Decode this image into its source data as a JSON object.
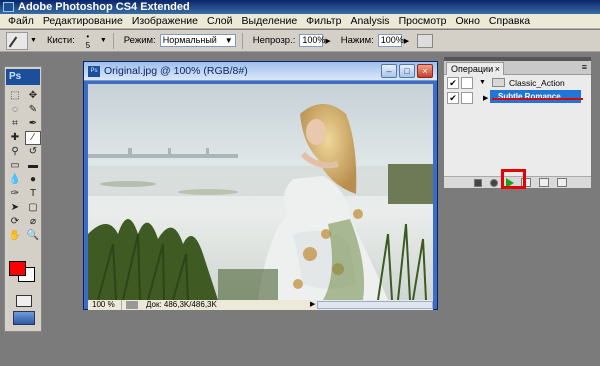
{
  "app": {
    "title": "Adobe Photoshop CS4 Extended"
  },
  "menu": [
    "Файл",
    "Редактирование",
    "Изображение",
    "Слой",
    "Выделение",
    "Фильтр",
    "Analysis",
    "Просмотр",
    "Окно",
    "Справка"
  ],
  "options": {
    "brushes_label": "Кисти:",
    "brush_size": "5",
    "mode_label": "Режим:",
    "mode_value": "Нормальный",
    "opacity_label": "Непрозр.:",
    "opacity_value": "100%",
    "flow_label": "Нажим:",
    "flow_value": "100%"
  },
  "toolbox": {
    "logo": "Ps",
    "foreground_color": "#ff0000",
    "background_color": "#ffffff"
  },
  "document": {
    "title": "Original.jpg @ 100% (RGB/8#)",
    "icon_text": "Ps",
    "zoom": "100 %",
    "doc_size": "Док: 486,3K/486,3K"
  },
  "actions_panel": {
    "tab_label": "Операции",
    "close": "×",
    "menu": "≡",
    "rows": [
      {
        "label": "Classic_Action",
        "checked": "✔"
      },
      {
        "label": "Subtle Romance",
        "checked": "✔",
        "selected": true
      }
    ]
  },
  "colors": {
    "accent_selection": "#1f76d6",
    "highlight": "#e80000"
  }
}
